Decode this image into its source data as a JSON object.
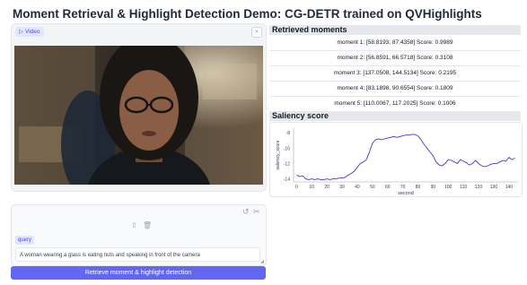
{
  "title": "Moment Retrieval & Highlight Detection Demo: CG-DETR trained on QVHighlights",
  "video": {
    "label": "Video",
    "chip_icon": "video-icon",
    "close_icon": "close-icon"
  },
  "query": {
    "label": "query",
    "value": "A woman wearing a glass is eating nuts and speaking in front of the camera",
    "icons": [
      "undo-icon",
      "scissors-icon",
      "share-icon",
      "trash-icon"
    ]
  },
  "button": {
    "label": "Retrieve moment & highlight detection"
  },
  "moments": {
    "header": "Retrieved moments",
    "items": [
      "moment 1: [58.8193, 87.4358] Score: 0.9989",
      "moment 2: [56.8591, 66.5718] Score: 0.3108",
      "moment 3: [137.0508, 144.5134] Score: 0.2195",
      "moment 4: [83.1898, 90.6554] Score: 0.1809",
      "moment 5: [110.0067, 117.2025] Score: 0.1006"
    ]
  },
  "saliency": {
    "header": "Saliency score",
    "chart_data": {
      "type": "line",
      "xlabel": "second",
      "ylabel": "saliency_score",
      "xlim": [
        -2,
        146
      ],
      "ylim": [
        -14.4,
        -7.4
      ],
      "xticks": [
        0,
        10,
        20,
        30,
        40,
        50,
        60,
        70,
        80,
        90,
        100,
        110,
        120,
        130,
        140
      ],
      "yticks": [
        -8,
        -10,
        -12,
        -14
      ],
      "color": "#4338ca",
      "x": [
        0,
        2,
        4,
        6,
        8,
        10,
        12,
        14,
        16,
        18,
        20,
        22,
        24,
        26,
        28,
        30,
        32,
        34,
        36,
        38,
        40,
        42,
        44,
        46,
        48,
        50,
        52,
        54,
        56,
        58,
        60,
        62,
        64,
        66,
        68,
        70,
        72,
        74,
        76,
        78,
        80,
        82,
        84,
        86,
        88,
        90,
        92,
        94,
        96,
        98,
        100,
        102,
        104,
        106,
        108,
        110,
        112,
        114,
        116,
        118,
        120,
        122,
        124,
        126,
        128,
        130,
        132,
        134,
        136,
        138,
        140,
        142,
        144
      ],
      "y": [
        -13.5,
        -13.7,
        -13.6,
        -14.0,
        -14.1,
        -14.0,
        -14.1,
        -14.0,
        -14.1,
        -14.1,
        -14.0,
        -14.1,
        -14.0,
        -14.0,
        -13.9,
        -13.9,
        -13.8,
        -13.5,
        -13.3,
        -13.0,
        -12.5,
        -12.0,
        -11.8,
        -11.5,
        -10.5,
        -9.4,
        -8.9,
        -8.8,
        -8.9,
        -8.8,
        -8.7,
        -8.6,
        -8.5,
        -8.6,
        -8.5,
        -8.4,
        -8.3,
        -8.3,
        -8.2,
        -8.2,
        -8.4,
        -8.9,
        -9.5,
        -10.0,
        -10.5,
        -11.0,
        -11.8,
        -12.2,
        -12.3,
        -12.0,
        -11.5,
        -11.6,
        -11.8,
        -12.0,
        -11.5,
        -11.7,
        -11.9,
        -12.2,
        -12.0,
        -11.6,
        -12.0,
        -12.3,
        -12.4,
        -12.3,
        -12.1,
        -12.0,
        -12.0,
        -11.8,
        -11.6,
        -11.7,
        -11.2,
        -11.5,
        -11.3
      ]
    }
  }
}
